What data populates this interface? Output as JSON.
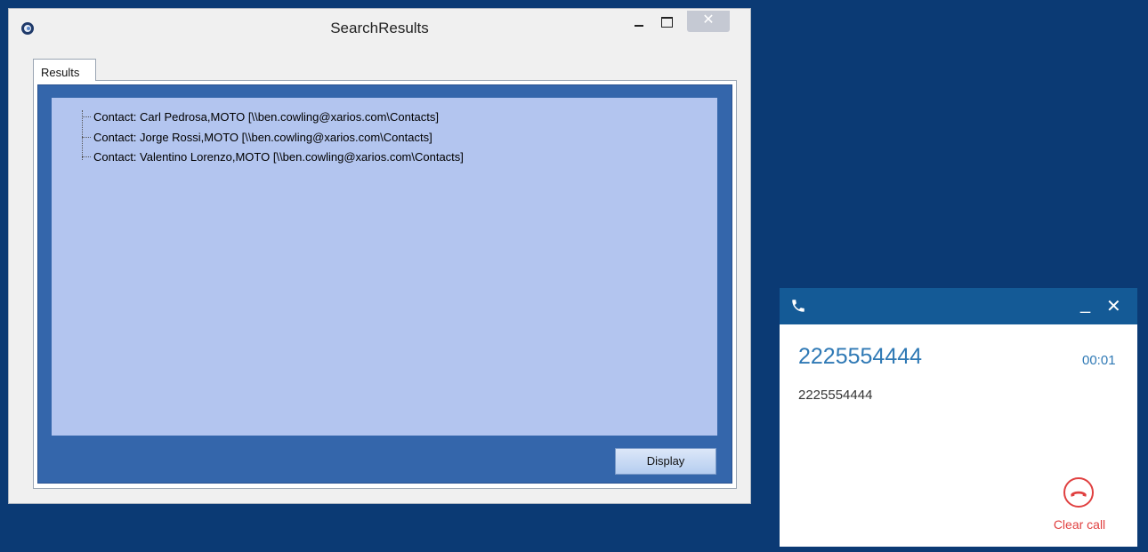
{
  "window": {
    "title": "SearchResults",
    "close_glyph": "✕"
  },
  "tab": {
    "label": "Results"
  },
  "results": [
    "Contact: Carl Pedrosa,MOTO  [\\\\ben.cowling@xarios.com\\Contacts]",
    "Contact: Jorge Rossi,MOTO  [\\\\ben.cowling@xarios.com\\Contacts]",
    "Contact: Valentino Lorenzo,MOTO  [\\\\ben.cowling@xarios.com\\Contacts]"
  ],
  "display_button": {
    "label": "Display"
  },
  "call_panel": {
    "number": "2225554444",
    "timer": "00:01",
    "subtitle": "2225554444",
    "minimize_glyph": "_",
    "close_glyph": "✕",
    "clear_label": "Clear call"
  },
  "colors": {
    "desktop": "#0b3a74",
    "panel": "#3466ab",
    "tree_bg": "#b3c5ef",
    "call_header": "#145a96",
    "accent": "#2f79b5",
    "clear": "#e04040"
  },
  "icons": [
    "app-icon",
    "minimize-icon",
    "maximize-icon",
    "close-icon",
    "phone-icon",
    "hangup-icon"
  ]
}
